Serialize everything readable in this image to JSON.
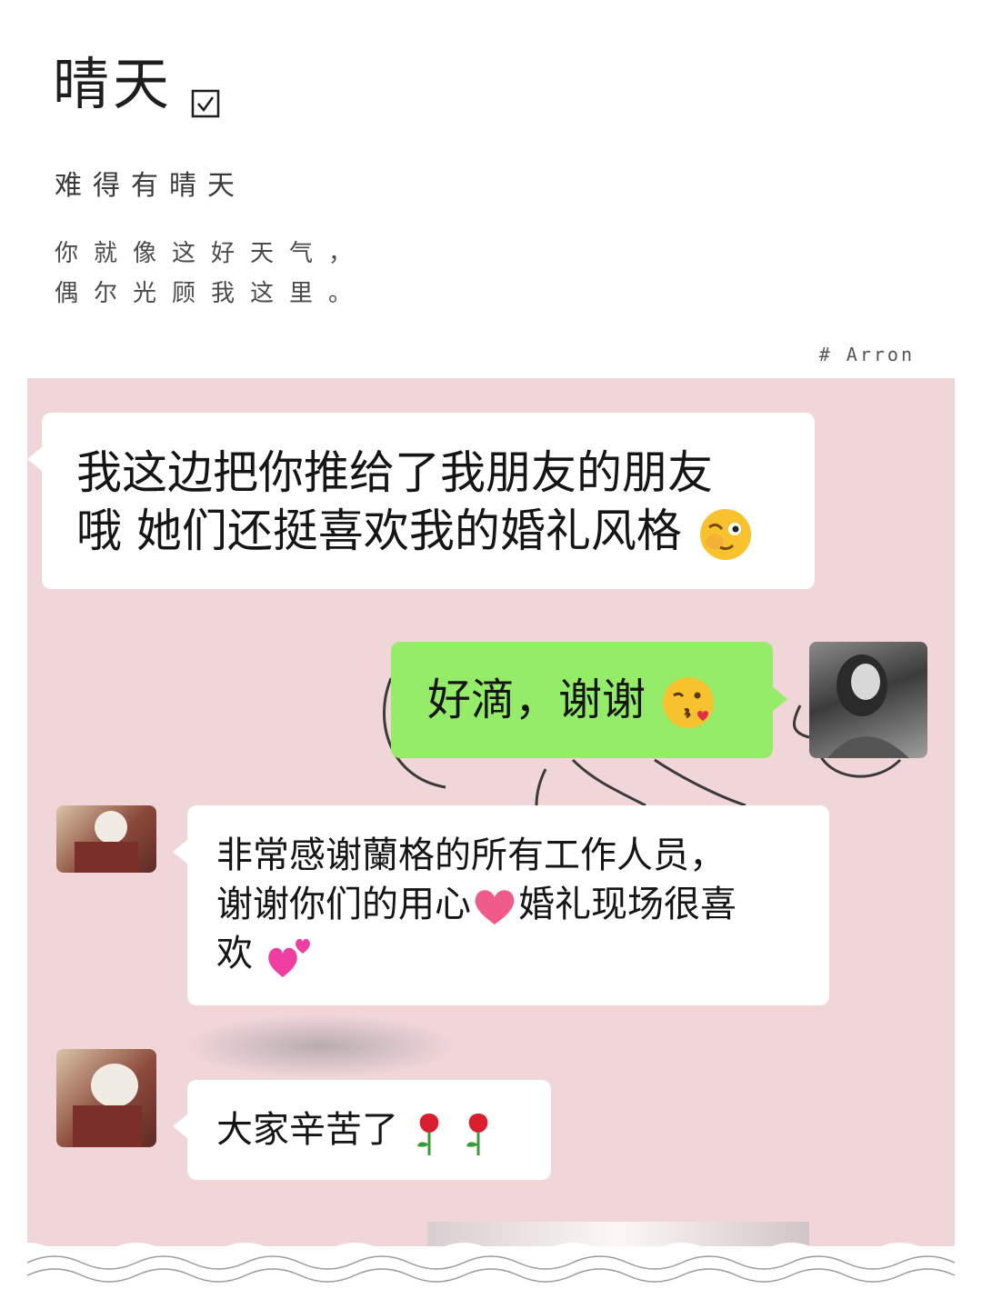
{
  "header": {
    "title": "晴天",
    "check_icon": "checkbox-check-icon",
    "subtitle": "难得有晴天",
    "poem_line_1": "你就像这好天气，",
    "poem_line_2": "偶尔光顾我这里。",
    "author": "# Arron"
  },
  "chat": {
    "messages": [
      {
        "side": "left",
        "line_1": "我这边把你推给了我朋友的朋友",
        "line_2": "哦 她们还挺喜欢我的婚礼风格",
        "emoji": "wink-emoji-icon"
      },
      {
        "side": "right",
        "text": "好滴，谢谢",
        "emoji": "kiss-emoji-icon"
      },
      {
        "side": "left",
        "line_1": "非常感谢蘭格的所有工作人员，",
        "line_2a": "谢谢你们的用心",
        "line_2b": "婚礼现场很喜",
        "line_3": "欢",
        "emoji_1": "heart-emoji-icon",
        "emoji_2": "two-hearts-emoji-icon"
      },
      {
        "side": "left",
        "text": "大家辛苦了",
        "emoji": "rose-emoji-icon"
      }
    ]
  },
  "colors": {
    "chat_background": "#f0d5d9",
    "bubble_white": "#ffffff",
    "bubble_green": "#95ec69"
  }
}
